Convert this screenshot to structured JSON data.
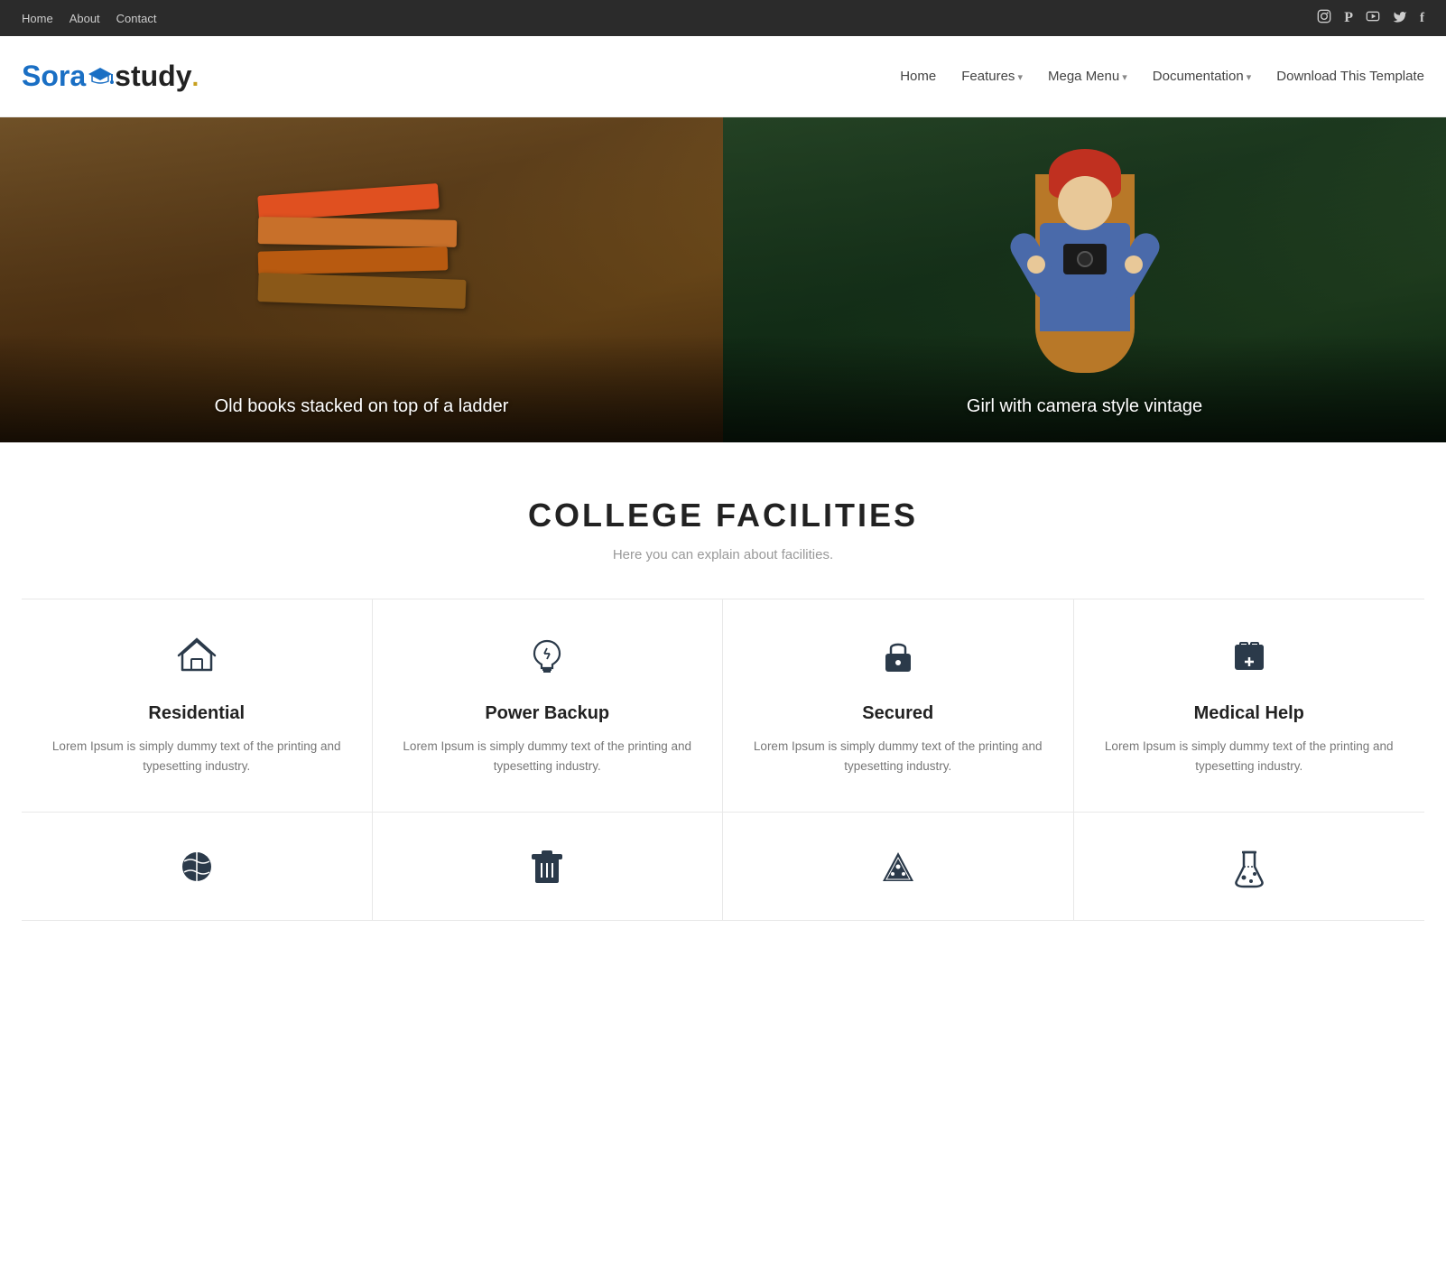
{
  "topBar": {
    "links": [
      {
        "label": "Home",
        "name": "top-nav-home"
      },
      {
        "label": "About",
        "name": "top-nav-about"
      },
      {
        "label": "Contact",
        "name": "top-nav-contact"
      }
    ],
    "social": [
      {
        "label": "Instagram",
        "icon": "⊡",
        "name": "social-instagram"
      },
      {
        "label": "Pinterest",
        "icon": "⊙",
        "name": "social-pinterest"
      },
      {
        "label": "YouTube",
        "icon": "▶",
        "name": "social-youtube"
      },
      {
        "label": "Twitter",
        "icon": "◈",
        "name": "social-twitter"
      },
      {
        "label": "Facebook",
        "icon": "f",
        "name": "social-facebook"
      }
    ]
  },
  "mainNav": {
    "logoSora": "Sora",
    "logoStudy": "study",
    "links": [
      {
        "label": "Home",
        "hasDropdown": false,
        "name": "nav-home"
      },
      {
        "label": "Features",
        "hasDropdown": true,
        "name": "nav-features"
      },
      {
        "label": "Mega Menu",
        "hasDropdown": true,
        "name": "nav-mega-menu"
      },
      {
        "label": "Documentation",
        "hasDropdown": true,
        "name": "nav-documentation"
      },
      {
        "label": "Download This Template",
        "hasDropdown": false,
        "name": "nav-download"
      }
    ]
  },
  "hero": {
    "leftLabel": "Old books stacked on top of a ladder",
    "rightLabel": "Girl with camera style vintage"
  },
  "facilities": {
    "title": "COLLEGE FACILITIES",
    "subtitle": "Here you can explain about facilities.",
    "cards": [
      {
        "name": "Residential",
        "icon": "🏠",
        "iconName": "home-icon",
        "desc": "Lorem Ipsum is simply dummy text of the printing and typesetting industry."
      },
      {
        "name": "Power Backup",
        "icon": "💡",
        "iconName": "bulb-icon",
        "desc": "Lorem Ipsum is simply dummy text of the printing and typesetting industry."
      },
      {
        "name": "Secured",
        "icon": "🔒",
        "iconName": "lock-icon",
        "desc": "Lorem Ipsum is simply dummy text of the printing and typesetting industry."
      },
      {
        "name": "Medical Help",
        "icon": "🏥",
        "iconName": "medical-icon",
        "desc": "Lorem Ipsum is simply dummy text of the printing and typesetting industry."
      }
    ],
    "row2Icons": [
      {
        "iconName": "sports-icon",
        "symbol": "⚾"
      },
      {
        "iconName": "trash-icon",
        "symbol": "🗑"
      },
      {
        "iconName": "pizza-icon",
        "symbol": "🍕"
      },
      {
        "iconName": "lab-icon",
        "symbol": "🧪"
      }
    ]
  }
}
